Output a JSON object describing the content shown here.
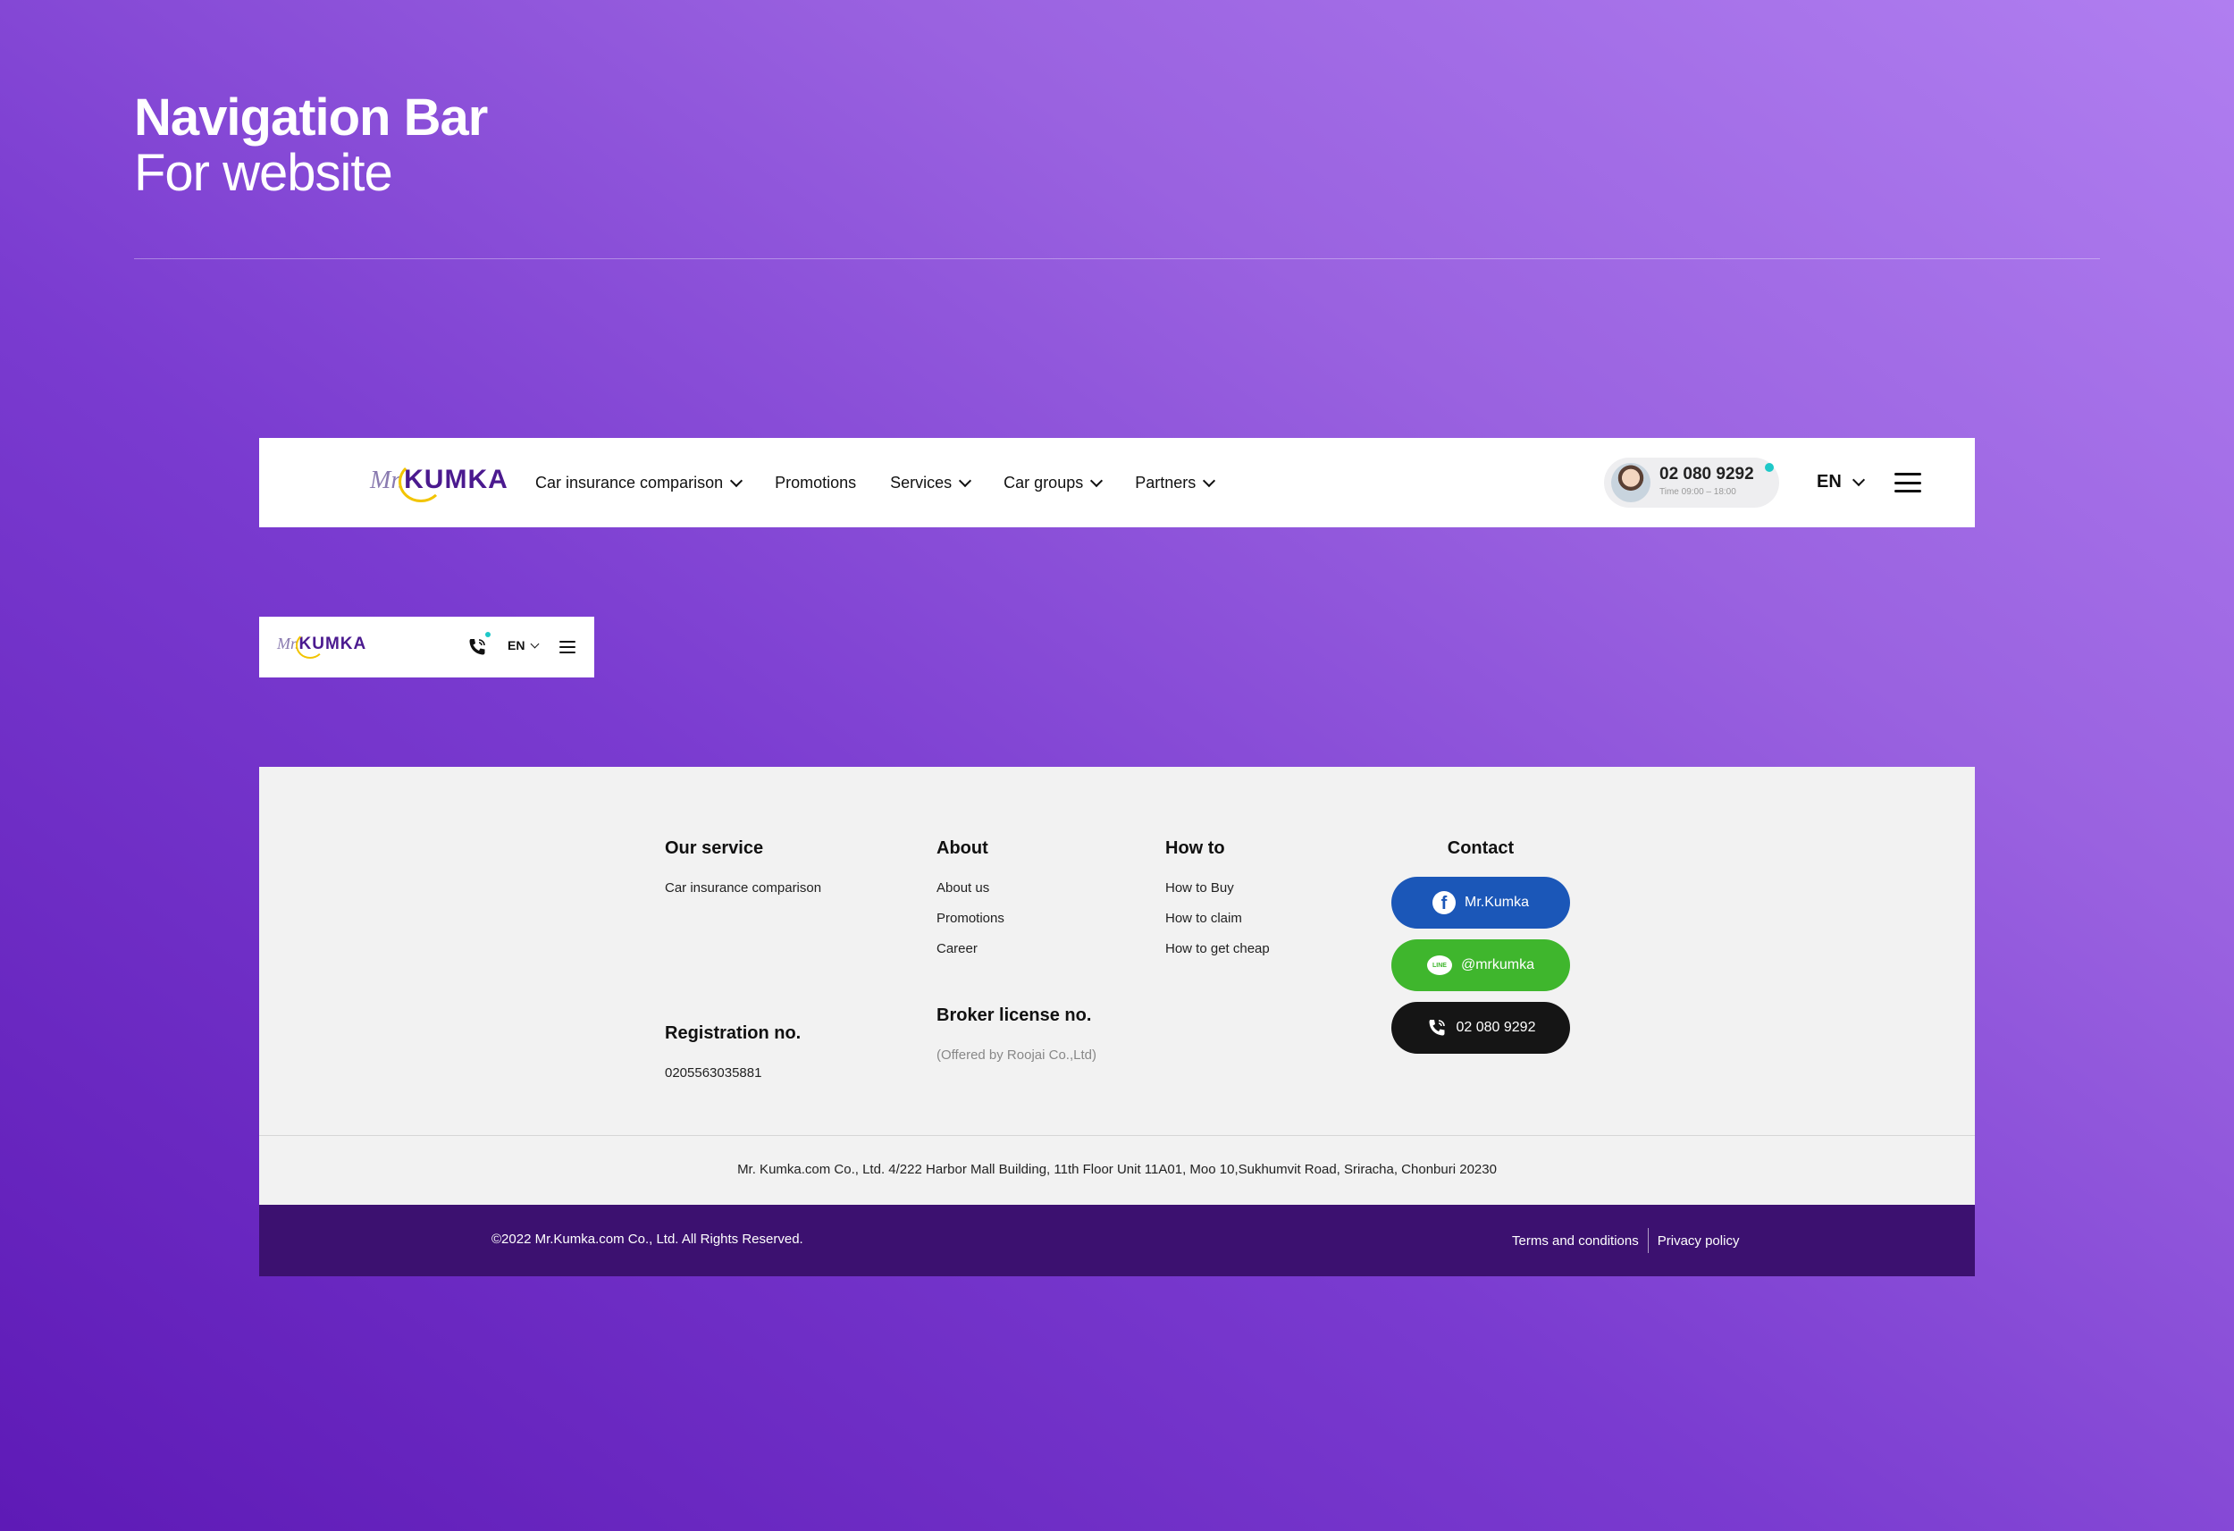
{
  "hero": {
    "title": "Navigation Bar",
    "subtitle": "For website"
  },
  "brand": {
    "logo_prefix": "Mr.",
    "logo_name": "KUMKA",
    "colors": {
      "primary": "#4b1a8f",
      "accent": "#f2c400",
      "status_dot": "#1ec8c8"
    }
  },
  "navbar": {
    "menu": [
      {
        "label": "Car insurance comparison",
        "dropdown": true
      },
      {
        "label": "Promotions",
        "dropdown": false
      },
      {
        "label": "Services",
        "dropdown": true
      },
      {
        "label": "Car groups",
        "dropdown": true
      },
      {
        "label": "Partners",
        "dropdown": true
      }
    ],
    "call": {
      "number": "02 080 9292",
      "hours": "Time 09:00 – 18:00"
    },
    "language": "EN",
    "icons": [
      "chevron-down-icon",
      "avatar",
      "hamburger-menu-icon"
    ]
  },
  "mobile_nav": {
    "language": "EN",
    "icons": [
      "phone-icon",
      "chevron-down-icon",
      "hamburger-menu-icon"
    ]
  },
  "footer": {
    "our_service": {
      "heading": "Our service",
      "links": [
        "Car insurance comparison"
      ]
    },
    "about": {
      "heading": "About",
      "links": [
        "About us",
        "Promotions",
        "Career"
      ]
    },
    "how_to": {
      "heading": "How to",
      "links": [
        "How to Buy",
        "How to claim",
        "How to get cheap"
      ]
    },
    "contact": {
      "heading": "Contact",
      "facebook": "Mr.Kumka",
      "line": "@mrkumka",
      "line_icon_text": "LINE",
      "phone": "02 080 9292"
    },
    "registration": {
      "heading": "Registration no.",
      "value": "0205563035881"
    },
    "broker": {
      "heading": "Broker license no.",
      "value": "(Offered by Roojai Co.,Ltd)"
    },
    "address": "Mr. Kumka.com Co., Ltd. 4/222 Harbor Mall Building, 11th Floor Unit 11A01, Moo 10,Sukhumvit Road, Sriracha, Chonburi 20230",
    "copyright": "©2022 Mr.Kumka.com Co., Ltd. All Rights Reserved.",
    "legal": {
      "terms": "Terms and conditions",
      "privacy": "Privacy policy"
    }
  }
}
